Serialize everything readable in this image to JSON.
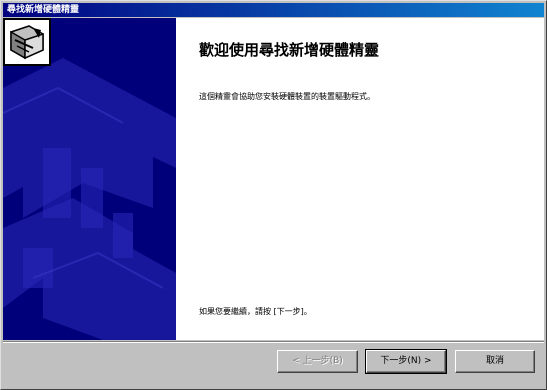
{
  "window": {
    "title": "尋找新增硬體精靈"
  },
  "main": {
    "heading": "歡迎使用尋找新增硬體精靈",
    "description": "這個精靈會協助您安裝硬體裝置的裝置驅動程式。",
    "continue_text": "如果您要繼續，請按 [下一步]。"
  },
  "buttons": {
    "back_label": "< 上一步(B)",
    "next_label": "下一步(N) >",
    "cancel_label": "取消"
  },
  "colors": {
    "sidebar": "#00007a",
    "titlebar": "#000080"
  },
  "icons": {
    "wizard": "hardware-wizard-icon"
  }
}
